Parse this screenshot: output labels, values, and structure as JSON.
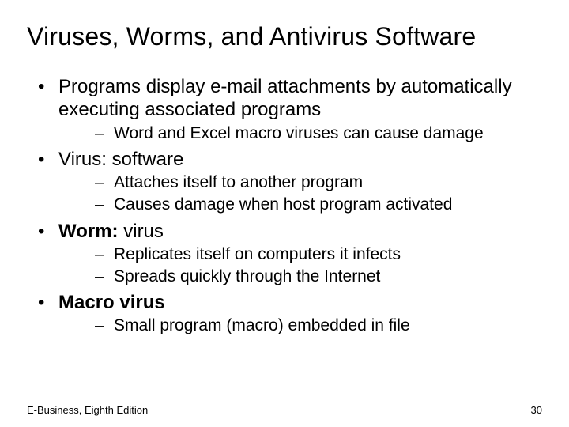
{
  "title": "Viruses, Worms, and Antivirus Software",
  "bullets": {
    "b1": "Programs display e-mail attachments by automatically executing associated programs",
    "b1_1": "Word and Excel macro viruses can cause damage",
    "b2": "Virus: software",
    "b2_1": "Attaches itself to another program",
    "b2_2": "Causes damage when host program activated",
    "b3_bold": "Worm:",
    "b3_rest": " virus",
    "b3_1": "Replicates itself on computers it infects",
    "b3_2": "Spreads quickly through the Internet",
    "b4": "Macro virus",
    "b4_1": "Small program (macro) embedded in file"
  },
  "footer": {
    "left": "E-Business, Eighth Edition",
    "right": "30"
  }
}
